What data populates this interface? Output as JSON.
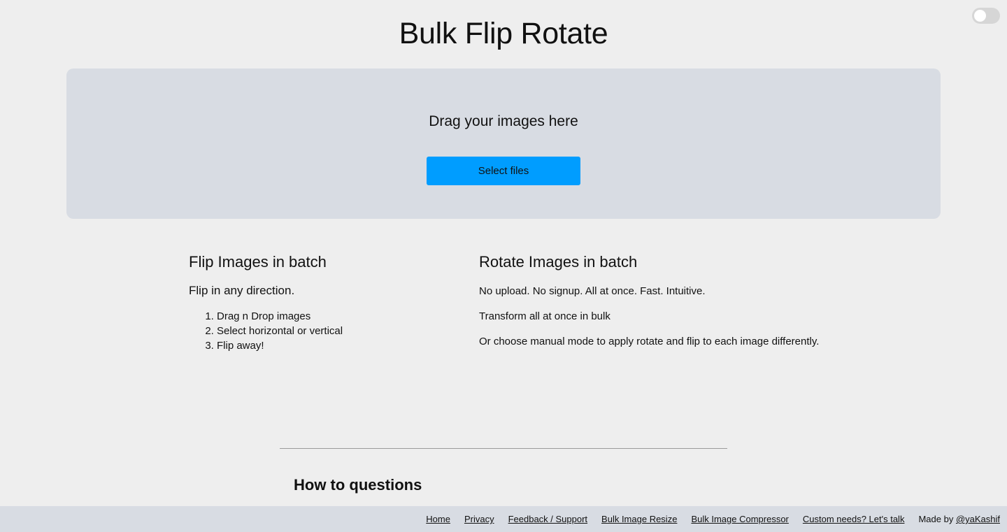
{
  "header": {
    "title": "Bulk Flip Rotate",
    "theme_toggle_state": "off"
  },
  "dropzone": {
    "prompt": "Drag your images here",
    "button_label": "Select files"
  },
  "flip_section": {
    "title": "Flip Images in batch",
    "subtitle": "Flip in any direction.",
    "steps": [
      "Drag n Drop images",
      "Select horizontal or vertical",
      "Flip away!"
    ]
  },
  "rotate_section": {
    "title": "Rotate Images in batch",
    "paragraphs": [
      "No upload. No signup. All at once. Fast. Intuitive.",
      "Transform all at once in bulk",
      "Or choose manual mode to apply rotate and flip to each image differently."
    ]
  },
  "howto": {
    "title": "How to questions"
  },
  "footer": {
    "links": [
      "Home",
      "Privacy",
      "Feedback / Support",
      "Bulk Image Resize",
      "Bulk Image Compressor",
      "Custom needs? Let's talk"
    ],
    "made_by_prefix": "Made by ",
    "made_by_link": "@yaKashif"
  },
  "colors": {
    "background": "#eeeeee",
    "panel": "#d8dce3",
    "accent_button": "#009dff"
  }
}
